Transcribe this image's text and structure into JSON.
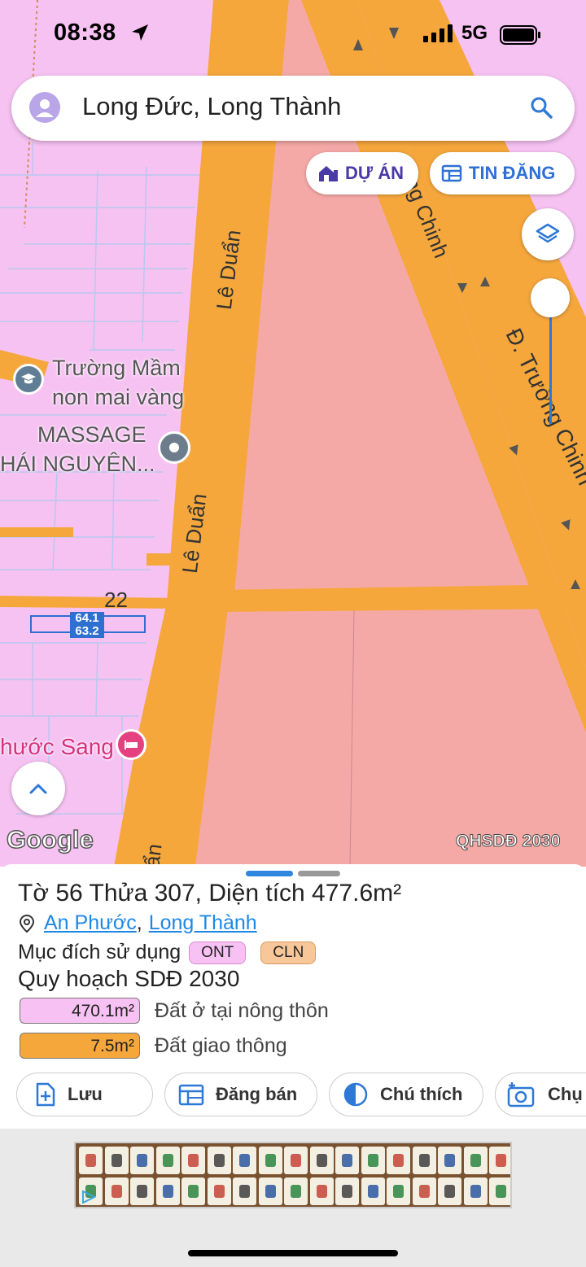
{
  "status_bar": {
    "time": "08:38",
    "network": "5G"
  },
  "search": {
    "text": "Long Đức, Long Thành"
  },
  "map_buttons": {
    "du_an": "DỰ ÁN",
    "tin_dang": "TIN ĐĂNG"
  },
  "map_labels": {
    "road_le_duan_1": "Lê Duẩn",
    "road_le_duan_2": "Lê Duẩn",
    "road_le_duan_3": "ẩn",
    "road_truong_chinh_1": "Đ. Trường Chinh",
    "road_truong_chinh_2": "ờng Chinh",
    "poi_school_line1": "Trường Mầm",
    "poi_school_line2": "non mai vàng",
    "poi_massage_line1": "MASSAGE",
    "poi_massage_line2": "HÁI NGUYÊN...",
    "poi_hotel": "hước Sang",
    "parcel_number": "22",
    "measure_top": "64.1",
    "measure_bottom": "63.2",
    "google": "Google",
    "layer_name": "QHSDĐ 2030"
  },
  "parcel": {
    "title": "Tờ 56 Thửa 307, Diện tích 477.6m²",
    "ward": "An Phước",
    "district": "Long Thành",
    "separator": ",",
    "purpose_label": "Mục đích sử dụng",
    "purpose_tags": [
      "ONT",
      "CLN"
    ],
    "plan_title": "Quy hoạch SDĐ 2030",
    "areas": [
      {
        "value": "470.1m²",
        "label": "Đất ở tại nông thôn",
        "color": "#f7c2f3"
      },
      {
        "value": "7.5m²",
        "label": "Đất giao thông",
        "color": "#f5a73c"
      }
    ]
  },
  "actions": {
    "save": "Lưu",
    "post_sale": "Đăng bán",
    "legend": "Chú thích",
    "photo": "Chụ"
  },
  "colors": {
    "road": "#f5a73c",
    "residential": "#f6c2f2",
    "planned": "#f5a9a6",
    "accent": "#2e6fd0"
  }
}
